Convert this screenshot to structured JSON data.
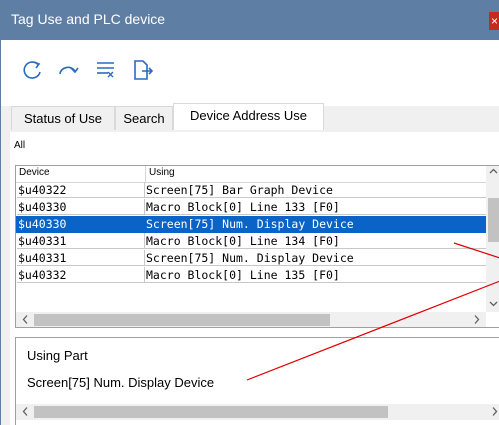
{
  "window": {
    "title": "Tag Use and PLC device",
    "close_glyph": "×"
  },
  "toolbar": {
    "buttons": [
      "refresh-icon",
      "redo-icon",
      "filter-list-icon",
      "export-icon"
    ]
  },
  "tabs": [
    {
      "label": "Status of Use"
    },
    {
      "label": "Search"
    },
    {
      "label": "Device Address Use",
      "active": true
    }
  ],
  "filter_label": "All",
  "table": {
    "columns": [
      "Device",
      "Using"
    ],
    "rows": [
      {
        "device": "$u40322",
        "using": "Screen[75] Bar Graph  Device"
      },
      {
        "device": "$u40330",
        "using": "Macro Block[0] Line 133 [F0]"
      },
      {
        "device": "$u40330",
        "using": "Screen[75] Num. Display Device",
        "selected": true
      },
      {
        "device": "$u40331",
        "using": "Macro Block[0] Line 134 [F0]"
      },
      {
        "device": "$u40331",
        "using": "Screen[75] Num. Display Device"
      },
      {
        "device": "$u40332",
        "using": "Macro Block[0] Line 135 [F0]"
      }
    ]
  },
  "using_part": {
    "label": "Using Part",
    "value": "Screen[75] Num. Display Device"
  },
  "colors": {
    "titlebar": "#5f7ea3",
    "selection": "#0a64c8",
    "annotation": "#e00000"
  }
}
